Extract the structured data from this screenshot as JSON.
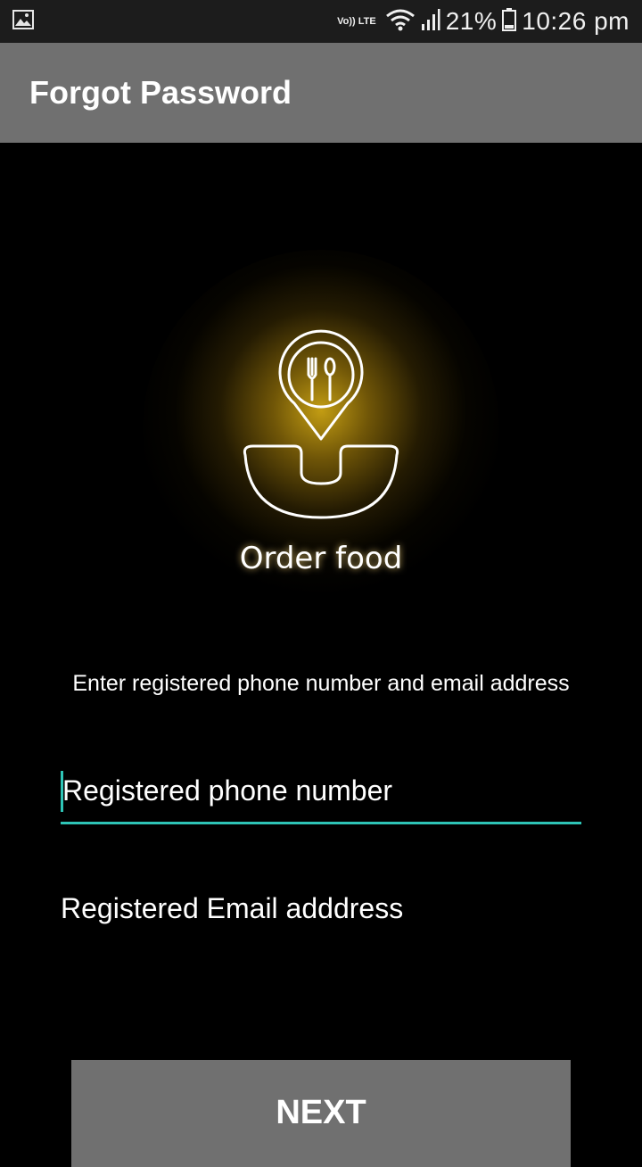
{
  "status_bar": {
    "network_label": "Vo)) LTE",
    "battery_percent": "21%",
    "time": "10:26 pm",
    "icons": [
      "image-notification-icon",
      "wifi-icon",
      "signal-icon",
      "battery-icon"
    ]
  },
  "app_bar": {
    "title": "Forgot Password"
  },
  "logo": {
    "caption": "Order food",
    "glow_color": "#cda514"
  },
  "form": {
    "instruction": "Enter registered phone number and email address",
    "phone_placeholder": "Registered phone number",
    "email_placeholder": "Registered Email adddress",
    "accent_color": "#2ec4b6"
  },
  "actions": {
    "next_label": "NEXT"
  }
}
